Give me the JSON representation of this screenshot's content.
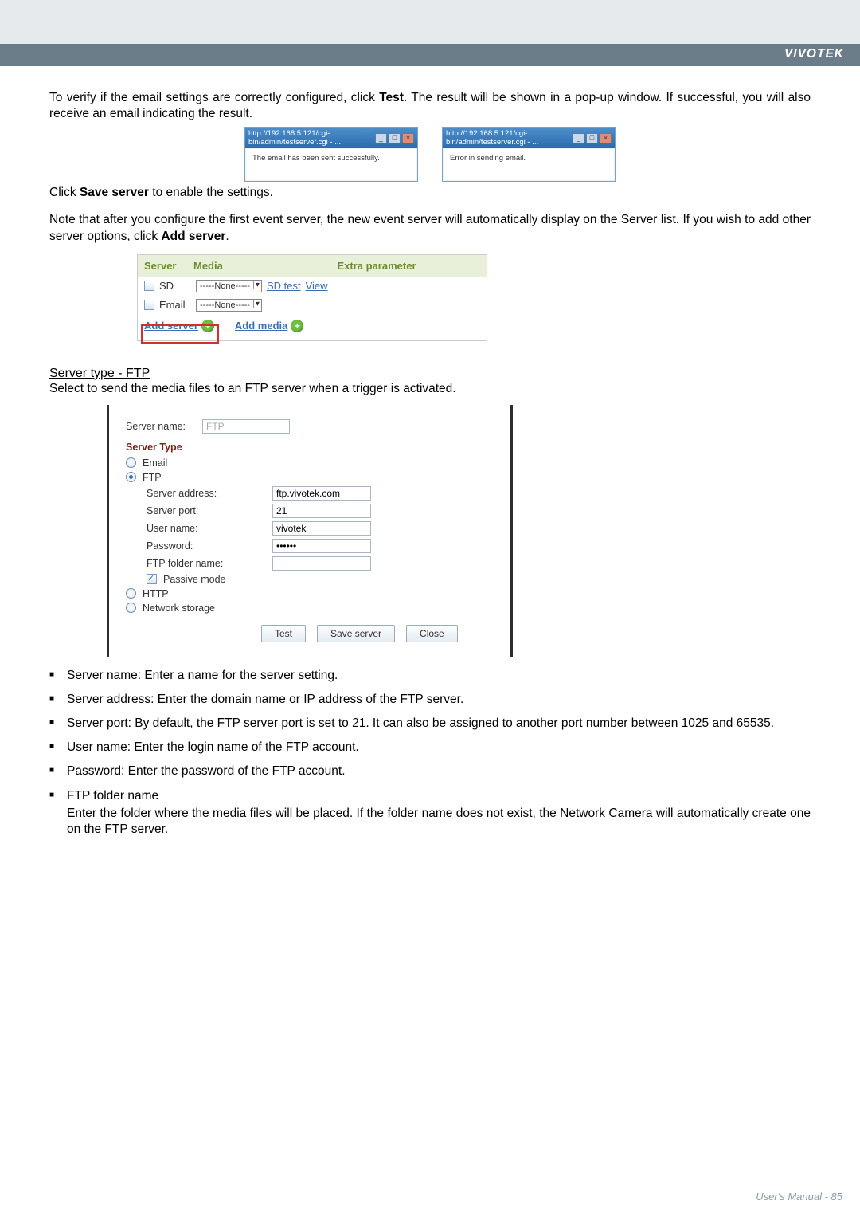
{
  "brand": "VIVOTEK",
  "intro1a": "To verify if the email settings are correctly configured, click ",
  "intro1b": "Test",
  "intro1c": ". The result will be shown in a pop-up window. If successful, you will also receive an email indicating the result.",
  "popupUrlA": "http://192.168.5.121/cgi-bin/admin/testserver.cgi - ...",
  "popupUrlB": "http://192.168.5.121/cgi-bin/admin/testserver.cgi - ...",
  "popupBodyA": "The email has been sent successfully.",
  "popupBodyB": "Error in sending email.",
  "clickSaveA": "Click ",
  "clickSaveB": "Save server",
  "clickSaveC": " to enable the settings.",
  "note1a": "Note that after you configure the first event server, the new event server will automatically display on the Server list. If you wish to add other server options, click ",
  "note1b": "Add server",
  "note1c": ".",
  "th_server": "Server",
  "th_media": "Media",
  "th_extra": "Extra parameter",
  "row_sd": "SD",
  "row_email": "Email",
  "sel_none": "-----None-----",
  "link_sdtest": "SD test",
  "link_view": "View",
  "add_server": "Add server",
  "add_media": "Add media",
  "serverTypeHead": "Server type - FTP",
  "serverTypeDesc": "Select to send the media files to an FTP server when a trigger is activated.",
  "lbl_servername": "Server name:",
  "val_servername": "FTP",
  "lbl_servertype": "Server Type",
  "opt_email": "Email",
  "opt_ftp": "FTP",
  "lbl_serveraddr": "Server address:",
  "val_serveraddr": "ftp.vivotek.com",
  "lbl_serverport": "Server port:",
  "val_serverport": "21",
  "lbl_username": "User name:",
  "val_username": "vivotek",
  "lbl_password": "Password:",
  "val_password": "••••••",
  "lbl_ftpfolder": "FTP folder name:",
  "lbl_passive": "Passive mode",
  "opt_http": "HTTP",
  "opt_netstor": "Network storage",
  "btn_test": "Test",
  "btn_save": "Save server",
  "btn_close": "Close",
  "li_servername": "Server name: Enter a name for the server setting.",
  "li_serveraddr": "Server address: Enter the domain name or IP address of the FTP server.",
  "li_serverport": "Server port: By default, the FTP server port is set to 21. It can also be assigned to another port number between 1025 and 65535.",
  "li_username": "User name: Enter the login name of the FTP account.",
  "li_password": "Password: Enter the password of the FTP account.",
  "li_ftpfolder_a": "FTP folder name",
  "li_ftpfolder_b": "Enter the folder where the media files will be placed. If the folder name does not exist, the Network Camera will automatically create one on the FTP server.",
  "footer_a": "User's Manual - ",
  "footer_b": "85"
}
